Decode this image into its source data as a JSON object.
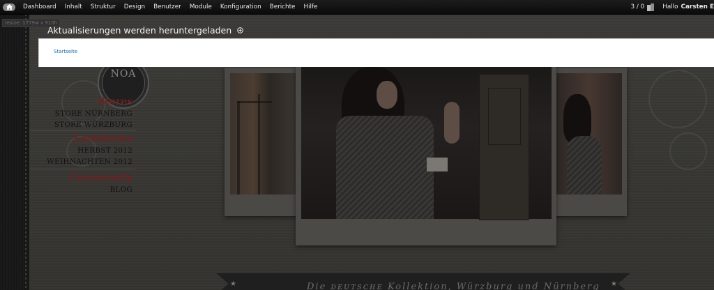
{
  "toolbar": {
    "home_icon": "home-icon",
    "menu": [
      {
        "label": "Dashboard"
      },
      {
        "label": "Inhalt"
      },
      {
        "label": "Struktur"
      },
      {
        "label": "Design"
      },
      {
        "label": "Benutzer"
      },
      {
        "label": "Module"
      },
      {
        "label": "Konfiguration"
      },
      {
        "label": "Berichte"
      },
      {
        "label": "Hilfe"
      }
    ],
    "counter": "3 / 0",
    "greeting_prefix": "Hallo",
    "user_name": "Carsten E"
  },
  "resize_tag": "resize: 1779w x 910h",
  "overlay": {
    "title": "Aktualisierungen werden heruntergeladen",
    "breadcrumb": "Startseite"
  },
  "site": {
    "logo_text": "NOA",
    "nav": [
      {
        "heading": "Stores",
        "links": [
          "STORE NÜRNBERG",
          "STORE WÜRZBURG"
        ]
      },
      {
        "heading": "Lookbooks",
        "links": [
          "HERBST 2012",
          "WEIHNACHTEN 2012"
        ]
      },
      {
        "heading": "Community",
        "links": [
          "BLOG"
        ]
      }
    ],
    "banner_text": "Die ᴅᴇᴜᴛsᴄʜᴇ Kollektion, Würzburg und Nürnberg"
  },
  "colors": {
    "toolbar_bg": "#0b0b0b",
    "overlay_panel": "#ffffff",
    "link_blue": "#1a6aa8",
    "nav_heading_red": "#6b2222"
  }
}
